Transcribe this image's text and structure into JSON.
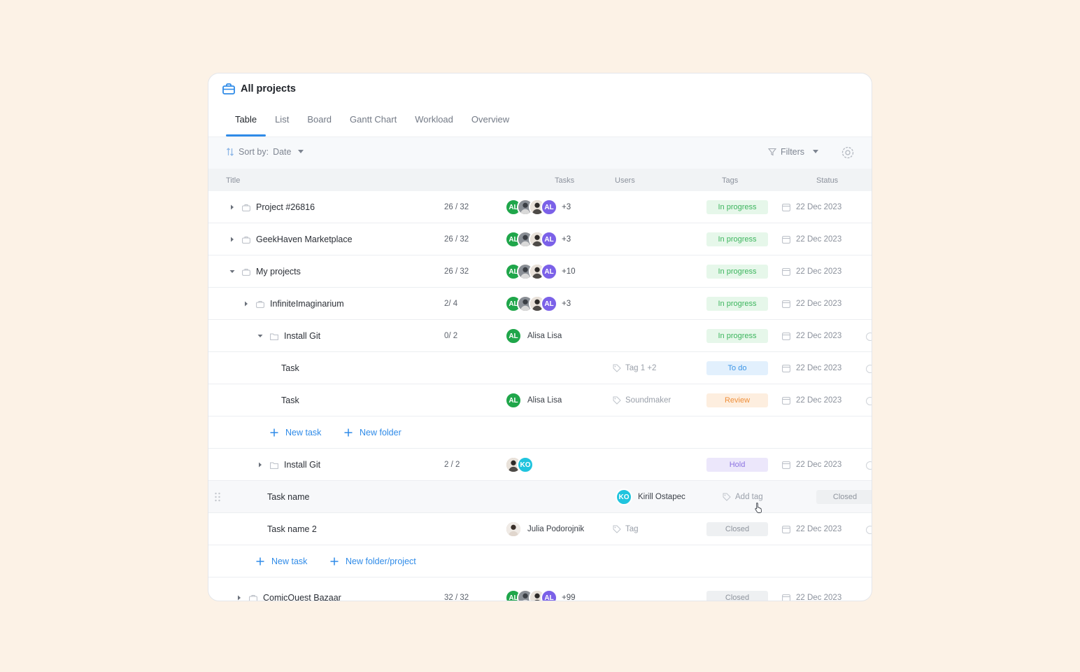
{
  "header": {
    "title": "All projects"
  },
  "tabs": [
    "Table",
    "List",
    "Board",
    "Gantt Chart",
    "Workload",
    "Overview"
  ],
  "toolbar": {
    "sort_label": "Sort by:",
    "sort_value": "Date",
    "filters_label": "Filters"
  },
  "columns": {
    "title": "Title",
    "tasks": "Tasks",
    "users": "Users",
    "tags": "Tags",
    "status": "Status"
  },
  "rows": [
    {
      "title": "Project #26816",
      "count": "26 / 32",
      "more": "+3",
      "status": "In progress",
      "date": "22 Dec 2023"
    },
    {
      "title": "GeekHaven Marketplace",
      "count": "26 / 32",
      "more": "+3",
      "status": "In progress",
      "date": "22 Dec 2023"
    },
    {
      "title": "My projects",
      "count": "26 / 32",
      "more": "+10",
      "status": "In progress",
      "date": "22 Dec 2023"
    },
    {
      "title": "InfiniteImaginarium",
      "count": "2/ 4",
      "more": "+3",
      "status": "In progress",
      "date": "22 Dec 2023"
    },
    {
      "title": "Install Git",
      "count": "0/ 2",
      "avatar": "AL",
      "user": "Alisa Lisa",
      "status": "In progress",
      "date": "22 Dec 2023"
    },
    {
      "title": "Task",
      "tag": "Tag 1 +2",
      "status": "To do",
      "date": "22 Dec 2023"
    },
    {
      "title": "Task",
      "avatar": "AL",
      "user": "Alisa Lisa",
      "tag": "Soundmaker",
      "status": "Review",
      "date": "22 Dec 2023"
    },
    {
      "new_task": "New task",
      "new_folder": "New folder"
    },
    {
      "title": "Install Git",
      "count": "2 / 2",
      "avatar": "KO",
      "status": "Hold",
      "date": "22 Dec 2023"
    },
    {
      "title": "Task name",
      "avatar": "KO",
      "user": "Kirill Ostapec",
      "tag": "Add tag",
      "status": "Closed"
    },
    {
      "title": "Task name 2",
      "user": "Julia Podorojnik",
      "tag": "Tag",
      "status": "Closed",
      "date": "22 Dec 2023"
    },
    {
      "new_task": "New task",
      "new_folder": "New folder/project"
    },
    {
      "title": "ComicQuest Bazaar",
      "count": "32 / 32",
      "more": "+99",
      "status": "Closed",
      "date": "22 Dec 2023"
    }
  ],
  "avatar_initials": "AL",
  "colors": {
    "accent": "#2f8be8",
    "in_progress": "#3cb55d",
    "to_do": "#3c95e6",
    "review": "#ee8f3b",
    "hold": "#8b73e1",
    "closed": "#8e949d"
  }
}
